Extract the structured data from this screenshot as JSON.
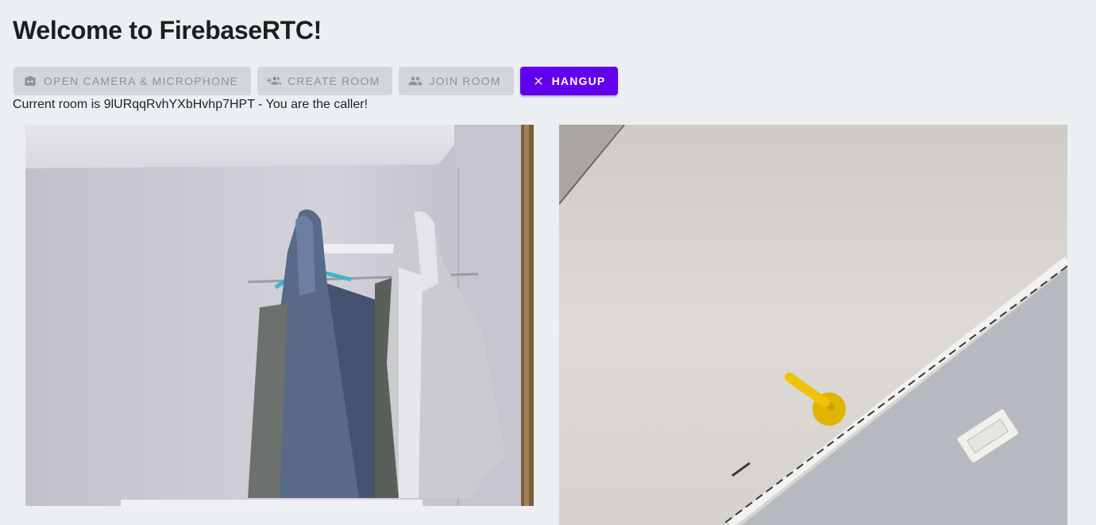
{
  "header": {
    "title": "Welcome to FirebaseRTC!"
  },
  "toolbar": {
    "camera_label": "Open camera & microphone",
    "create_label": "Create room",
    "join_label": "Join room",
    "hangup_label": "Hangup"
  },
  "room": {
    "status_text": "Current room is 9lURqqRvhYXbHvhp7HPT - You are the caller!"
  },
  "icons": {
    "camera": "camera-switch-icon",
    "create": "group-add-icon",
    "join": "group-icon",
    "hangup": "close-icon"
  },
  "colors": {
    "background": "#eceff1",
    "primary": "#6200ee",
    "disabled_bg": "#d3d6d8",
    "disabled_text": "#8f9395"
  }
}
